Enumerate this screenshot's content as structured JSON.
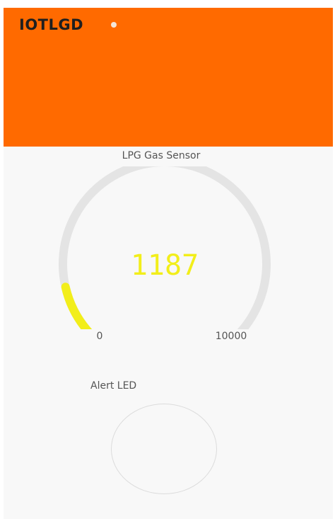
{
  "header": {
    "title": "IOTLGD",
    "background": "#ff6a00",
    "status_dot_color": "#f3e5d8"
  },
  "gauge": {
    "label": "LPG Gas Sensor",
    "value": 1187,
    "value_text": "1187",
    "min": "0",
    "max": "10000",
    "fill_color": "#f2ee1a",
    "track_color": "#e4e4e4"
  },
  "alert_led": {
    "label": "Alert LED",
    "state": "off",
    "outline_color": "#dcdcdc"
  }
}
